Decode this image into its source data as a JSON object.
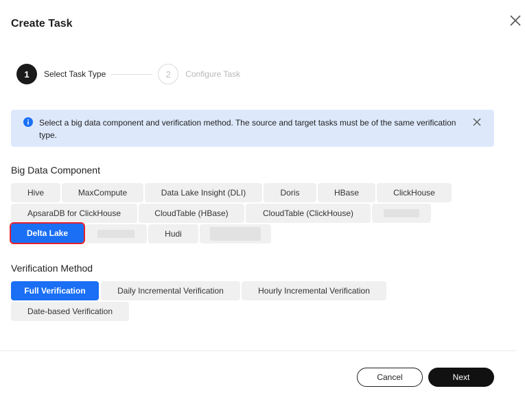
{
  "dialog": {
    "title": "Create Task"
  },
  "steps": [
    {
      "number": "1",
      "label": "Select Task Type",
      "state": "active"
    },
    {
      "number": "2",
      "label": "Configure Task",
      "state": "inactive"
    }
  ],
  "alert": {
    "text": "Select a big data component and verification method. The source and target tasks must be of the same verification type."
  },
  "big_data_component": {
    "label": "Big Data Component",
    "options": [
      "Hive",
      "MaxCompute",
      "Data Lake Insight (DLI)",
      "Doris",
      "HBase",
      "ClickHouse",
      "ApsaraDB for ClickHouse",
      "CloudTable (HBase)",
      "CloudTable (ClickHouse)",
      "",
      "Delta Lake",
      "",
      "Hudi",
      ""
    ],
    "selected": "Delta Lake"
  },
  "verification_method": {
    "label": "Verification Method",
    "options": [
      "Full Verification",
      "Daily Incremental Verification",
      "Hourly Incremental Verification",
      "Date-based Verification"
    ],
    "selected": "Full Verification"
  },
  "footer": {
    "cancel_label": "Cancel",
    "next_label": "Next"
  },
  "colors": {
    "primary": "#1a6ff5",
    "alert_bg": "#dde9fb",
    "highlight": "#e5212b",
    "dark": "#111111"
  }
}
